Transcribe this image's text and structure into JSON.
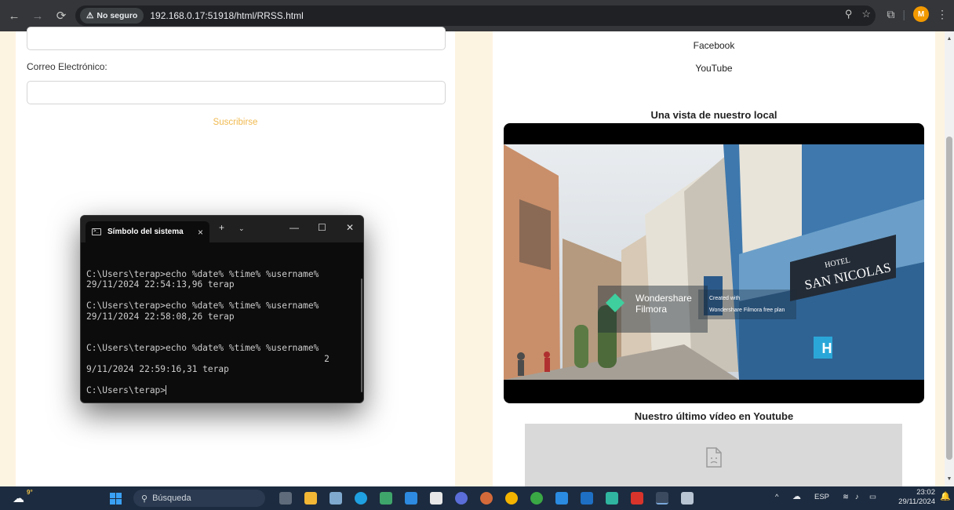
{
  "browser": {
    "security_label": "No seguro",
    "url": "192.168.0.17:51918/html/RRSS.html",
    "profile_initial": "M"
  },
  "form": {
    "email_label": "Correo Electrónico:",
    "email_value": "",
    "subscribe_label": "Suscribirse"
  },
  "links": [
    "Facebook",
    "YouTube"
  ],
  "video_section": {
    "title": "Una vista de nuestro local",
    "hotel_sign_top": "HOTEL",
    "hotel_sign_bottom": "SAN NICOLAS",
    "watermark_brand": "Wondershare",
    "watermark_product": "Filmora",
    "watermark_note_1": "Created with",
    "watermark_note_2": "Wondershare Filmora free plan"
  },
  "youtube_section": {
    "title": "Nuestro último vídeo en Youtube"
  },
  "terminal": {
    "tab_title": "Símbolo del sistema",
    "lines": [
      "C:\\Users\\terap>echo %date% %time% %username%",
      "29/11/2024 22:54:13,96 terap",
      "",
      "C:\\Users\\terap>echo %date% %time% %username%",
      "29/11/2024 22:58:08,26 terap",
      "",
      "",
      "C:\\Users\\terap>echo %date% %time% %username%",
      "                                             2",
      "9/11/2024 22:59:16,31 terap",
      "",
      "C:\\Users\\terap>"
    ]
  },
  "taskbar": {
    "weather": "9°",
    "search_placeholder": "Búsqueda",
    "language": "ESP",
    "time": "23:02",
    "date": "29/11/2024"
  },
  "colors": {
    "page_background": "#fdf3e1",
    "subscribe_text": "#f0b94f",
    "terminal_background": "#0c0c0c",
    "taskbar_background": "#1c2b3f"
  }
}
